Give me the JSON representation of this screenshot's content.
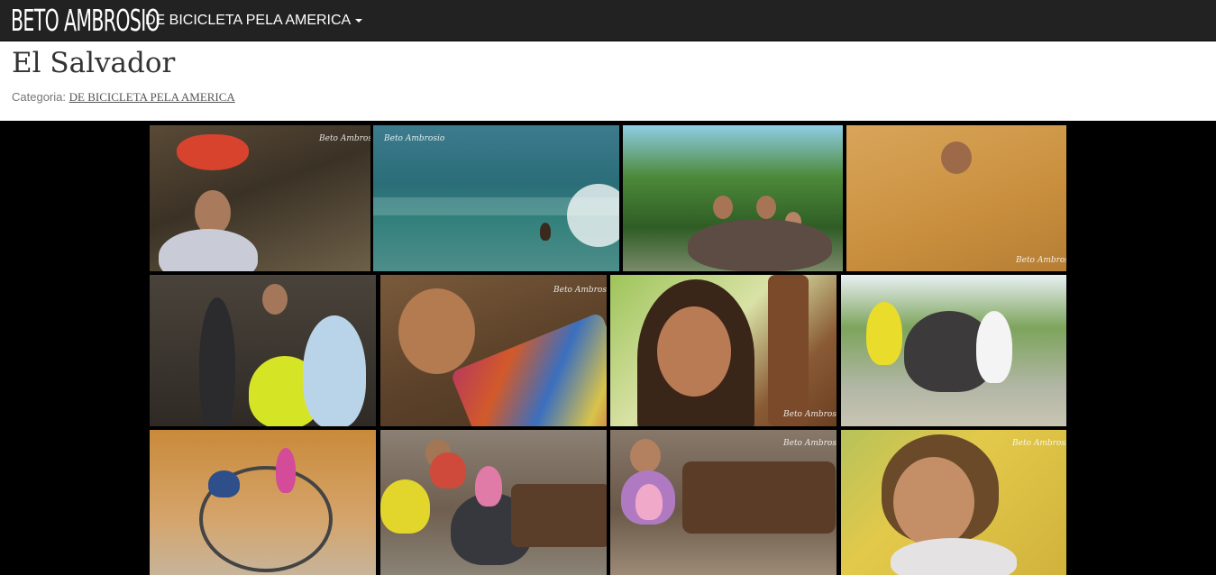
{
  "navbar": {
    "brand": "BETO AMBROSIO",
    "menu_label": "DE BICICLETA PELA AMERICA"
  },
  "page": {
    "title": "El Salvador",
    "category_prefix": "Categoria:",
    "category_link": "DE BICICLETA PELA AMERICA"
  },
  "gallery": {
    "watermark": "Beto Ambrosio",
    "photos": [
      {
        "subject": "woman carrying basket of fruit on head"
      },
      {
        "subject": "surfer riding a wave"
      },
      {
        "subject": "three friends sitting in garden"
      },
      {
        "subject": "child swimming in muddy water"
      },
      {
        "subject": "family group portrait"
      },
      {
        "subject": "child in colorful hammock"
      },
      {
        "subject": "girl portrait by tree"
      },
      {
        "subject": "group with loaded bicycle on road"
      },
      {
        "subject": "girl on touring bicycle against wall"
      },
      {
        "subject": "family sitting by firewood"
      },
      {
        "subject": "little girl with teddy bear by firewood"
      },
      {
        "subject": "smiling little girl close-up"
      }
    ]
  },
  "colors": {
    "navbar_bg": "#222222",
    "page_bg": "#000000",
    "header_bg": "#ffffff"
  }
}
